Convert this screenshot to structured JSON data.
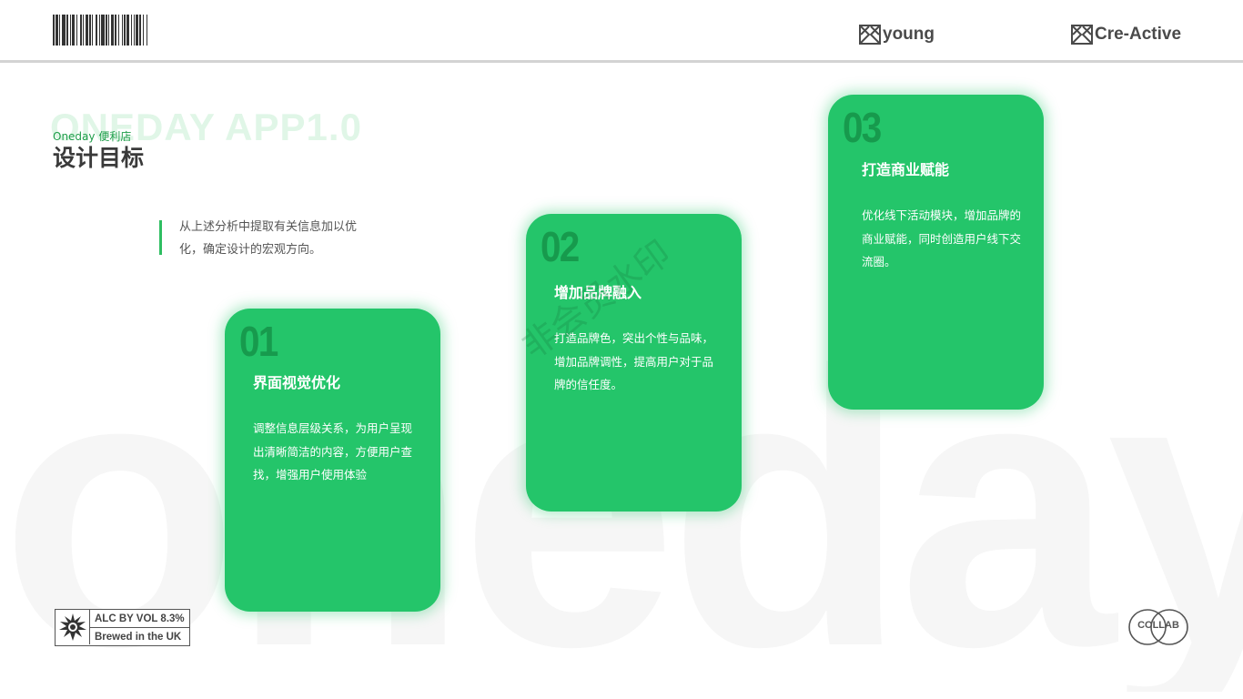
{
  "background_word": "oneday",
  "header": {
    "brand_left": "young",
    "brand_right": "Cre-Active"
  },
  "page": {
    "background_title": "ONEDAY APP1.0",
    "subtitle": "Oneday 便利店",
    "title": "设计目标",
    "intro": "从上述分析中提取有关信息加以优化，确定设计的宏观方向。"
  },
  "cards": [
    {
      "number": "01",
      "title": "界面视觉优化",
      "description": "调整信息层级关系，为用户呈现出清晰简洁的内容，方便用户查找，增强用户使用体验"
    },
    {
      "number": "02",
      "title": "增加品牌融入",
      "description": "打造品牌色，突出个性与品味，增加品牌调性，提高用户对于品牌的信任度。"
    },
    {
      "number": "03",
      "title": "打造商业赋能",
      "description": "优化线下活动模块，增加品牌的商业赋能，同时创造用户线下交流圈。"
    }
  ],
  "watermark": "非会员水印",
  "footer": {
    "badge_line1": "ALC BY VOL 8.3%",
    "badge_line2": "Brewed in the UK",
    "collab_label": "COLLAB"
  },
  "colors": {
    "accent_green": "#24c56a",
    "number_green": "#179a4d",
    "subtitle_green": "#1f9e4a"
  }
}
